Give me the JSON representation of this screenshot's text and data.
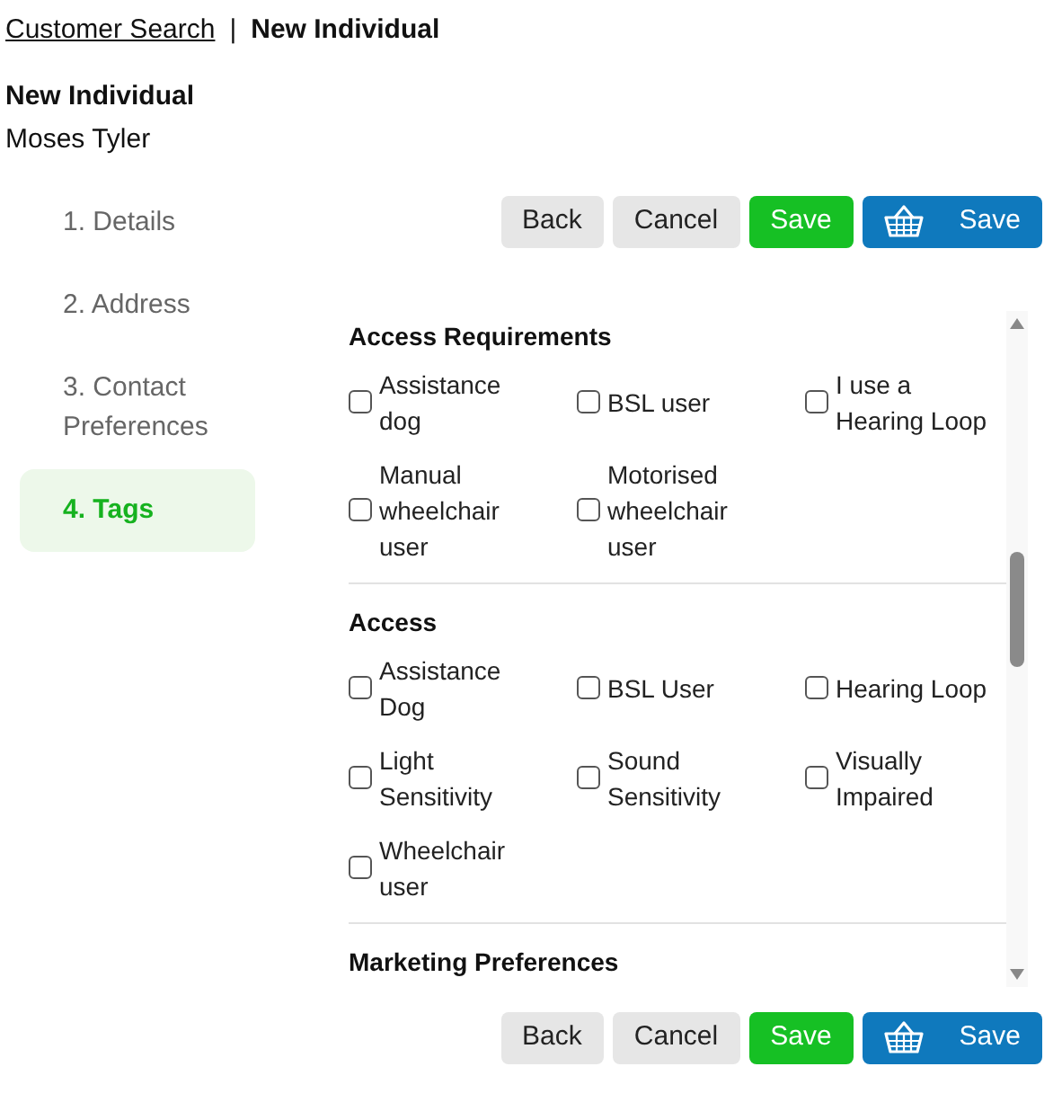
{
  "breadcrumb": {
    "link": "Customer Search",
    "separator": "|",
    "current": "New Individual"
  },
  "header": {
    "title": "New Individual",
    "subtitle": "Moses Tyler"
  },
  "steps": [
    {
      "label": "1. Details",
      "selected": false
    },
    {
      "label": "2. Address",
      "selected": false
    },
    {
      "label": "3. Contact Preferences",
      "selected": false
    },
    {
      "label": "4. Tags",
      "selected": true
    }
  ],
  "top_buttons": [
    {
      "kind": "secondary",
      "label": "Back"
    },
    {
      "kind": "secondary",
      "label": "Cancel"
    },
    {
      "kind": "primary",
      "label": "Save"
    },
    {
      "kind": "basket",
      "label": "Save"
    }
  ],
  "sections": [
    {
      "title": "Access Requirements",
      "options": [
        {
          "label": "Assistance dog",
          "checked": false
        },
        {
          "label": "BSL user",
          "checked": false
        },
        {
          "label": "I use a Hearing Loop",
          "checked": false
        },
        {
          "label": "Manual wheelchair user",
          "checked": false
        },
        {
          "label": "Motorised wheelchair user",
          "checked": false
        }
      ]
    },
    {
      "title": "Access",
      "options": [
        {
          "label": "Assistance Dog",
          "checked": false
        },
        {
          "label": "BSL User",
          "checked": false
        },
        {
          "label": "Hearing Loop",
          "checked": false
        },
        {
          "label": "Light Sensitivity",
          "checked": false
        },
        {
          "label": "Sound Sensitivity",
          "checked": false
        },
        {
          "label": "Visually Impaired",
          "checked": false
        },
        {
          "label": "Wheelchair user",
          "checked": false
        }
      ]
    },
    {
      "title": "Marketing Preferences"
    }
  ],
  "bottom_buttons": [
    {
      "kind": "secondary",
      "label": "Back"
    },
    {
      "kind": "secondary",
      "label": "Cancel"
    },
    {
      "kind": "primary",
      "label": "Save"
    },
    {
      "kind": "basket",
      "label": "Save"
    }
  ]
}
